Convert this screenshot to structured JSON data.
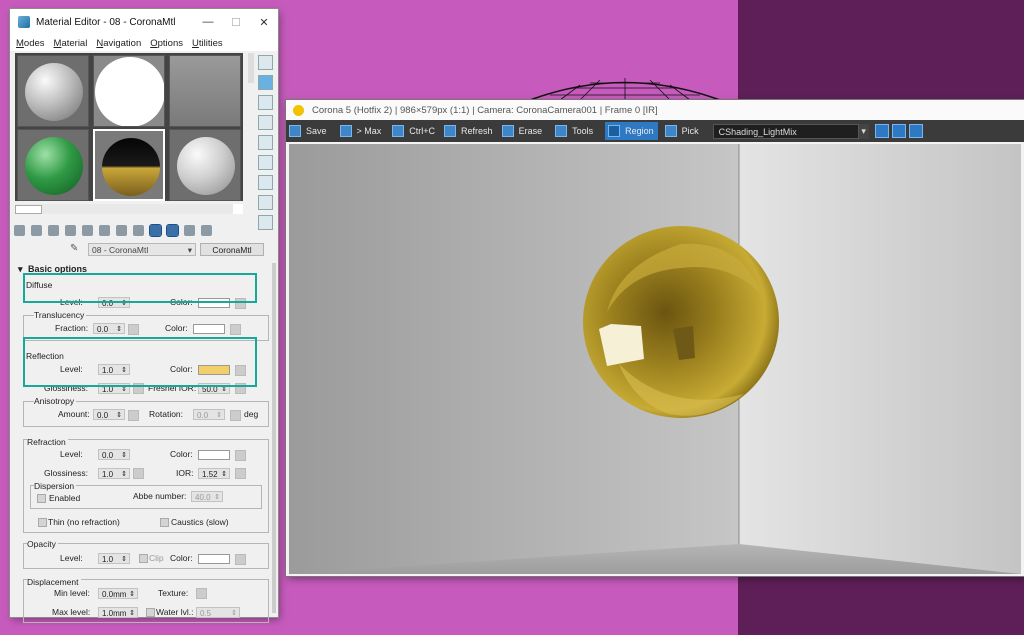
{
  "material_editor": {
    "title": "Material Editor - 08 - CoronaMtl",
    "window_controls": {
      "minimize": "—",
      "maximize": "☐",
      "close": "✕"
    },
    "menu": [
      "Modes",
      "Material",
      "Navigation",
      "Options",
      "Utilities"
    ],
    "material_name": "08 - CoronaMtl",
    "material_type": "CoronaMtl",
    "rollout_title": "Basic options",
    "diffuse": {
      "title": "Diffuse",
      "level_label": "Level:",
      "level": "0.0",
      "color_label": "Color:",
      "color": "#ffffff"
    },
    "translucency": {
      "title": "Translucency",
      "fraction_label": "Fraction:",
      "fraction": "0.0",
      "color_label": "Color:",
      "color": "#ffffff"
    },
    "reflection": {
      "title": "Reflection",
      "level_label": "Level:",
      "level": "1.0",
      "color_label": "Color:",
      "color": "#f3cf6a",
      "glossiness_label": "Glossiness:",
      "glossiness": "1.0",
      "ior_label": "Fresnel IOR:",
      "ior": "50.0"
    },
    "anisotropy": {
      "title": "Anisotropy",
      "amount_label": "Amount:",
      "amount": "0.0",
      "rotation_label": "Rotation:",
      "rotation": "0.0",
      "unit": "deg"
    },
    "refraction": {
      "title": "Refraction",
      "level_label": "Level:",
      "level": "0.0",
      "color_label": "Color:",
      "color": "#ffffff",
      "glossiness_label": "Glossiness:",
      "glossiness": "1.0",
      "ior_label": "IOR:",
      "ior": "1.52"
    },
    "dispersion": {
      "title": "Dispersion",
      "enabled_label": "Enabled",
      "abbe_label": "Abbe number:",
      "abbe": "40.0"
    },
    "thin_label": "Thin (no refraction)",
    "caustics_label": "Caustics (slow)",
    "opacity": {
      "title": "Opacity",
      "level_label": "Level:",
      "level": "1.0",
      "clip_label": "Clip",
      "color_label": "Color:",
      "color": "#ffffff"
    },
    "displacement": {
      "title": "Displacement",
      "min_label": "Min level:",
      "min": "0.0mm",
      "texture_label": "Texture:",
      "max_label": "Max level:",
      "max": "1.0mm",
      "water_label": "Water lvl.:",
      "water": "0.5"
    }
  },
  "vfb": {
    "title": "Corona 5 (Hotfix 2) | 986×579px (1:1) | Camera: CoronaCamera001 | Frame 0 [IR]",
    "toolbar": {
      "save": "Save",
      "max": "> Max",
      "copy": "Ctrl+C",
      "refresh": "Refresh",
      "erase": "Erase",
      "tools": "Tools",
      "region": "Region",
      "pick": "Pick"
    },
    "lightmix_channel": "CShading_LightMix"
  },
  "colors": {
    "accent": "#2d79c4",
    "highlight": "#19a79a",
    "gold": "#c8a530"
  }
}
